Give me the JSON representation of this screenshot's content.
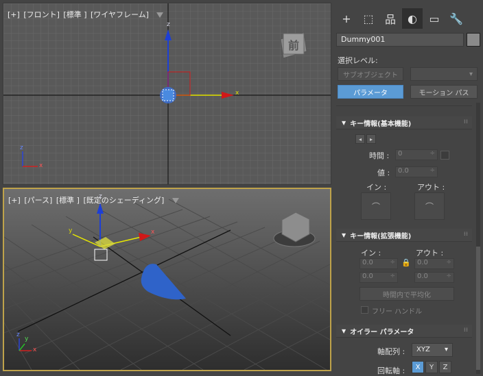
{
  "viewport_front": {
    "label_plus": "[+]",
    "label_view": "[フロント]",
    "label_mode": "[標準 ]",
    "label_shading": "[ワイヤフレーム]",
    "viewcube_face": "前",
    "gizmo_x": "x",
    "gizmo_z": "z",
    "axis_tripod_x": "x",
    "axis_tripod_z": "z"
  },
  "viewport_persp": {
    "label_plus": "[+]",
    "label_view": "[パース]",
    "label_mode": "[標準 ]",
    "label_shading": "[既定のシェーディング]",
    "gizmo_x": "x",
    "gizmo_y": "y",
    "gizmo_z": "z",
    "axis_tripod_x": "x",
    "axis_tripod_y": "y",
    "axis_tripod_z": "z"
  },
  "panel": {
    "tabs": [
      {
        "icon": "create-icon",
        "glyph": "+"
      },
      {
        "icon": "modify-icon",
        "glyph": "⬚"
      },
      {
        "icon": "hierarchy-icon",
        "glyph": "品"
      },
      {
        "icon": "motion-icon",
        "glyph": "◐"
      },
      {
        "icon": "display-icon",
        "glyph": "▭"
      },
      {
        "icon": "utilities-icon",
        "glyph": "🔧"
      }
    ],
    "object_name": "Dummy001",
    "selection_level_label": "選択レベル:",
    "subobject_button": "サブオブジェクト",
    "parameters_button": "パラメータ",
    "motion_paths_button": "モーション パス",
    "key_info_basic": {
      "title": "キー情報(基本機能)",
      "time_label": "時間 :",
      "time_value": "0",
      "value_label": "値 :",
      "value_value": "0.0",
      "in_label": "イン :",
      "out_label": "アウト :"
    },
    "key_info_advanced": {
      "title": "キー情報(拡張機能)",
      "in_label": "イン :",
      "out_label": "アウト :",
      "in_value_1": "0.0",
      "in_value_2": "0.0",
      "out_value_1": "0.0",
      "out_value_2": "0.0",
      "normalize_button": "時間内で平均化",
      "free_handle_label": "フリー ハンドル"
    },
    "euler": {
      "title": "オイラー パラメータ",
      "axis_order_label": "軸配列 :",
      "axis_order_value": "XYZ",
      "rotation_axis_label": "回転軸 :",
      "axis_x": "X",
      "axis_y": "Y",
      "axis_z": "Z"
    }
  }
}
